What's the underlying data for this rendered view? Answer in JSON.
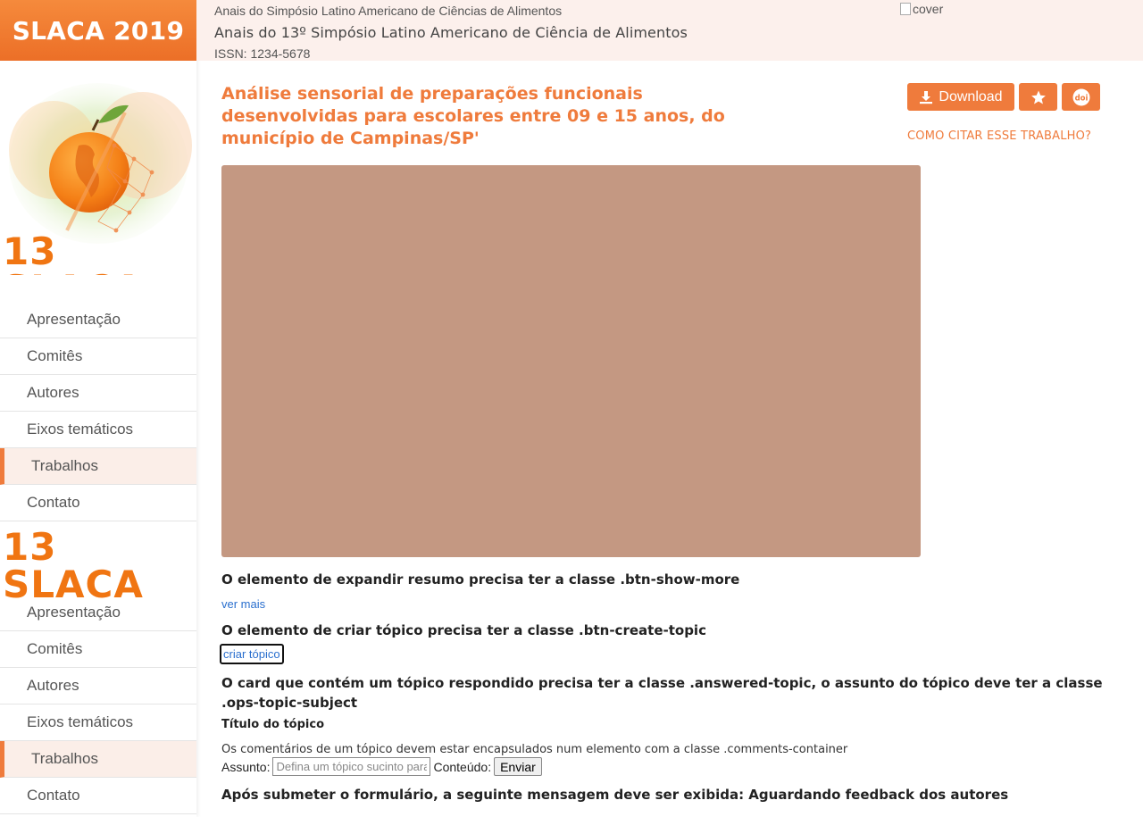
{
  "sidebar": {
    "brand": "SLACA 2019",
    "logo_text": "13 SLACA",
    "nav_primary": [
      {
        "label": "Apresentação",
        "active": false
      },
      {
        "label": "Comitês",
        "active": false
      },
      {
        "label": "Autores",
        "active": false
      },
      {
        "label": "Eixos temáticos",
        "active": false
      },
      {
        "label": "Trabalhos",
        "active": true
      },
      {
        "label": "Contato",
        "active": false
      }
    ],
    "nav_secondary": [
      {
        "label": "Apresentação",
        "active": false
      },
      {
        "label": "Comitês",
        "active": false
      },
      {
        "label": "Autores",
        "active": false
      },
      {
        "label": "Eixos temáticos",
        "active": false
      },
      {
        "label": "Trabalhos",
        "active": true
      },
      {
        "label": "Contato",
        "active": false
      }
    ]
  },
  "header": {
    "small_title": "Anais do Simpósio Latino Americano de Ciências de Alimentos",
    "main_title": "Anais do 13º Simpósio Latino Americano de Ciência de Alimentos",
    "issn": "ISSN: 1234-5678",
    "cover_alt": "cover"
  },
  "article": {
    "title": "Análise sensorial de preparações funcionais desenvolvidas para escolares entre 09 e 15 anos, do município de Campinas/SP'",
    "download_label": "Download",
    "doi_label": "doi",
    "cite_label": "COMO CITAR ESSE TRABALHO?"
  },
  "notes": {
    "show_more_note": "O elemento de expandir resumo precisa ter a classe .btn-show-more",
    "show_more_link": "ver mais",
    "create_topic_note": "O elemento de criar tópico precisa ter a classe .btn-create-topic",
    "create_topic_link": "criar tópico",
    "answered_topic_note": "O card que contém um tópico respondido precisa ter a classe .answered-topic, o assunto do tópico deve ter a classe .ops-topic-subject",
    "topic_title": "Título do tópico",
    "comments_note": "Os comentários de um tópico devem estar encapsulados num elemento com a classe .comments-container",
    "after_submit_note": "Após submeter o formulário, a seguinte mensagem deve ser exibida: Aguardando feedback dos autores"
  },
  "form": {
    "subject_label": "Assunto:",
    "subject_placeholder": "Defina um tópico sucinto para notificar os autores...",
    "content_label": "Conteúdo:",
    "send_label": "Enviar"
  },
  "colors": {
    "accent": "#ef7b3c",
    "header_bg": "#fcf0ec",
    "placeholder_bg": "#c49882",
    "link": "#2a6fce"
  },
  "icons": [
    "download-icon",
    "star-icon",
    "doi-icon",
    "broken-image-icon"
  ]
}
